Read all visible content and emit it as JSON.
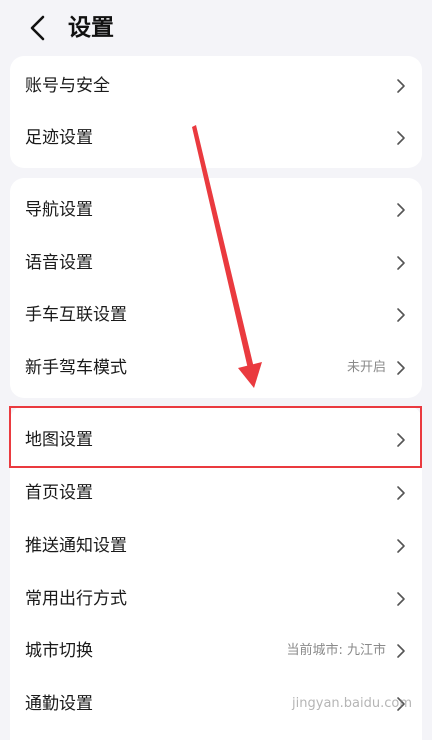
{
  "header": {
    "title": "设置",
    "back_icon": "chevron-left-icon"
  },
  "groups": [
    {
      "items": [
        {
          "label": "账号与安全"
        },
        {
          "label": "足迹设置"
        }
      ]
    },
    {
      "items": [
        {
          "label": "导航设置"
        },
        {
          "label": "语音设置"
        },
        {
          "label": "手车互联设置"
        },
        {
          "label": "新手驾车模式",
          "value": "未开启"
        }
      ]
    },
    {
      "items": [
        {
          "label": "地图设置",
          "highlighted": true
        },
        {
          "label": "首页设置"
        },
        {
          "label": "推送通知设置"
        },
        {
          "label": "常用出行方式"
        },
        {
          "label": "城市切换",
          "value": "当前城市: 九江市"
        },
        {
          "label": "通勤设置"
        }
      ]
    }
  ],
  "annotation": {
    "highlight_color": "#ea3a3f",
    "arrow_color": "#ea3a3f"
  },
  "watermark": {
    "text": "jingyan.baidu.com"
  }
}
